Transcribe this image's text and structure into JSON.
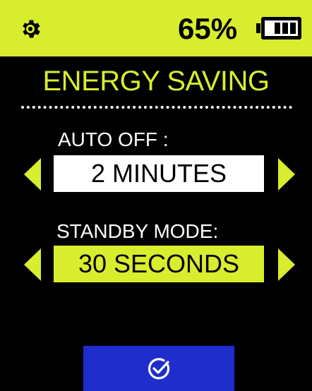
{
  "colors": {
    "accent": "#d9ed2f",
    "background": "#000000",
    "confirm": "#1f2dcc",
    "text_light": "#ffffff"
  },
  "statusbar": {
    "settings_icon": "gear-icon",
    "battery_percent": "65%",
    "battery_icon": "battery-icon",
    "battery_level": 0.65
  },
  "screen": {
    "title": "ENERGY SAVING"
  },
  "auto_off": {
    "label": "AUTO OFF :",
    "value": "2 MINUTES"
  },
  "standby_mode": {
    "label": "STANDBY  MODE:",
    "value": "30 SECONDS"
  },
  "confirm": {
    "icon": "check-circle-icon"
  }
}
